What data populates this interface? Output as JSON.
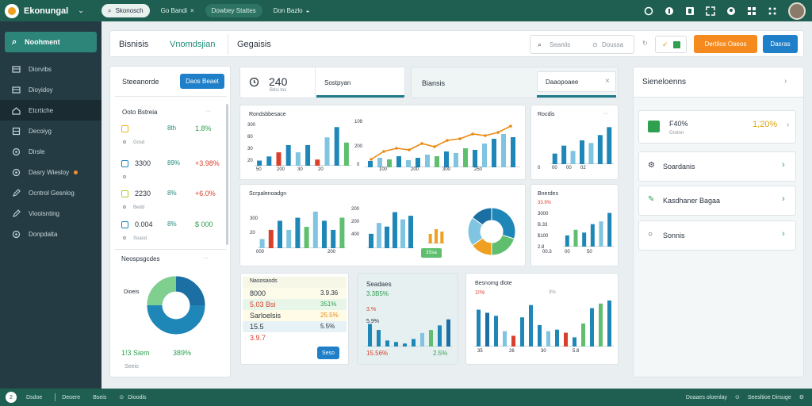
{
  "app": {
    "title": "Ekonungal"
  },
  "topbar": {
    "search_pill": "Skonosch",
    "tab1": "Go Bandi",
    "tab2": "Dowbey Stattes",
    "tab3": "Don Bazlo"
  },
  "sidebar": {
    "active": "Noohment",
    "items": [
      {
        "label": "Diorvibs",
        "icon": "table-icon"
      },
      {
        "label": "Dioyidoy",
        "icon": "table-icon"
      },
      {
        "label": "Etcrtiche",
        "icon": "home-icon"
      },
      {
        "label": "Decoiyg",
        "icon": "database-icon"
      },
      {
        "label": "Dirsle",
        "icon": "gauge-icon"
      },
      {
        "label": "Dasry Wiesloy",
        "icon": "gauge-icon"
      },
      {
        "label": "Ocntrol Gesnlog",
        "icon": "pencil-icon"
      },
      {
        "label": "Viooisnting",
        "icon": "pencil-icon"
      },
      {
        "label": "Donpdalta",
        "icon": "gauge-icon"
      }
    ]
  },
  "header": {
    "title": "Bisnisis",
    "subtitle": "Vnomdsjian",
    "tab": "Gegaisis",
    "search_placeholder": "Seaniis",
    "search_extra": "Doussa",
    "btn_orange": "Dertilos Oaeos",
    "btn_blue": "Dasras"
  },
  "left_panel": {
    "title": "Steeanorde",
    "button": "Daos Beaet",
    "section": "Ooto Bstreia",
    "rows": [
      {
        "value": "",
        "pct": "8th",
        "change": "1.8%",
        "sub": "Gosd"
      },
      {
        "value": "3300",
        "pct": "89%",
        "change": "+3.98%",
        "sub": ""
      },
      {
        "value": "2230",
        "pct": "8%",
        "change": "+6.0%",
        "sub": "Bedd"
      },
      {
        "value": "0.004",
        "pct": "8%",
        "change": "$ 000",
        "sub": "Soasd"
      }
    ],
    "donut_title": "Neospsgcdes",
    "donut_label": "Dioeis",
    "donut_footer_left": "1!3 Siem",
    "donut_footer_right": "389%",
    "donut_sub": "Seeio"
  },
  "kpi": {
    "value": "240",
    "sub": "Bdsi tos",
    "tab1": "Sostpyan",
    "tab2": "Biansis",
    "tab3": "Daaopoaee"
  },
  "right_panel": {
    "title": "Sieneloenns",
    "kpi_value": "F40%",
    "kpi_sub": "Grotnn",
    "kpi_change": "1,20%",
    "items": [
      {
        "label": "Soardanis",
        "icon": "gear-icon"
      },
      {
        "label": "Kasdhaner Bagaa",
        "icon": "pencil-icon"
      },
      {
        "label": "Sonnis",
        "icon": "circle-icon"
      }
    ]
  },
  "chart1": {
    "title": "Rondsbbesace",
    "yticks": [
      "300",
      "80",
      "30",
      "20"
    ],
    "xticks": [
      "50",
      "200",
      "30",
      "20"
    ]
  },
  "chart2": {
    "ytop": "109",
    "ymid": "200",
    "yzero": "0",
    "xticks": [
      "100",
      "200",
      "300",
      "250"
    ]
  },
  "chart3": {
    "title": "Rocdis",
    "xticks": [
      "0",
      "00",
      "00",
      "02"
    ]
  },
  "chart4": {
    "title": "Scrpalenoadgn",
    "yticks": [
      "200",
      "200",
      "400",
      "300",
      "20"
    ],
    "xticks": [
      "000",
      "200"
    ]
  },
  "chart5": {
    "title": "Bnerdes",
    "yticks": [
      "33.9%",
      "3000",
      "B.33",
      "$100",
      "2.8"
    ],
    "xticks": [
      "00.3",
      "00",
      "50"
    ]
  },
  "chart6": {
    "tag": "3Ssa"
  },
  "chart7": {
    "tag": "Dooeu"
  },
  "table_card": {
    "rows": [
      {
        "label": "Nasosasds",
        "value": ""
      },
      {
        "label": "8000",
        "value": "3.9.36"
      },
      {
        "label": "5.03 Bsi",
        "value": "351%"
      },
      {
        "label": "Sarloelsis",
        "value": "25.5%"
      },
      {
        "label": "15.5",
        "value": "5.5%"
      },
      {
        "label": "3.9.7",
        "value": ""
      }
    ],
    "button": "Seso"
  },
  "chart8": {
    "title": "Seadaes",
    "top": "3.3B5%",
    "v1": "3.%",
    "v2": "5.9%",
    "foot_left": "15.56%",
    "foot_right": "2.5%"
  },
  "chart9": {
    "title": "Besnomg dlote",
    "ytop": "1!%",
    "ymid": "3%",
    "xticks": [
      "35",
      "26",
      "30",
      "5.8"
    ]
  },
  "bottombar": {
    "items": [
      "Dsdoe",
      "Deoere",
      "Bseis",
      "Dioodis"
    ],
    "right1": "Doaaes oloenlay",
    "right2": "Seesltioe Dirsuge"
  },
  "colors": {
    "brand": "#1f5f52",
    "sidebar": "#243b43",
    "accent_teal": "#2d8479",
    "orange": "#f58a1f",
    "blue": "#1f7fc8",
    "green": "#2ea04f",
    "red": "#d9402b"
  },
  "chart_data": [
    {
      "type": "bar",
      "title": "Rondsbbesace",
      "categories": [
        "50",
        "200",
        "30",
        "20"
      ],
      "series": [
        {
          "values": [
            10,
            18,
            26,
            40,
            26,
            40,
            12,
            55,
            75,
            45
          ]
        }
      ]
    },
    {
      "type": "bar",
      "title": "Rocdis",
      "series": [
        {
          "values": [
            20,
            35,
            25,
            45,
            40,
            55,
            70
          ]
        }
      ]
    },
    {
      "type": "bar",
      "title": "Scrpalenoadgn",
      "series": [
        {
          "values": [
            15,
            30,
            45,
            30,
            50,
            35,
            60,
            45
          ]
        }
      ]
    },
    {
      "type": "pie",
      "series": [
        {
          "values": [
            30,
            20,
            15,
            20,
            15
          ]
        }
      ]
    },
    {
      "type": "bar",
      "title": "Besnomg dlote",
      "series": [
        {
          "values": [
            60,
            50,
            20,
            50,
            30,
            45,
            25,
            20,
            35,
            55,
            75,
            80
          ]
        }
      ]
    }
  ]
}
